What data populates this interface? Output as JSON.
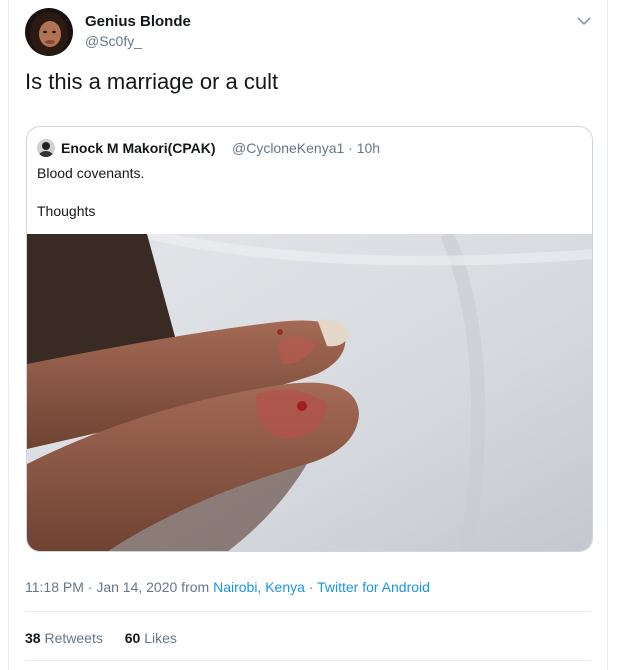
{
  "author": {
    "name": "Genius Blonde",
    "handle": "@Sc0fy_"
  },
  "tweet": {
    "text": "Is this a marriage or a cult"
  },
  "quoted": {
    "name": "Enock M Makori(CPAK)",
    "handle_time": "@CycloneKenya1 · 10h",
    "line1": "Blood covenants.",
    "line2": "Thoughts"
  },
  "meta": {
    "timestamp": "11:18 PM · Jan 14, 2020 from",
    "location": "Nairobi, Kenya",
    "separator": "·",
    "source": "Twitter for Android"
  },
  "stats": {
    "retweets_count": "38",
    "retweets_label": "Retweets",
    "likes_count": "60",
    "likes_label": "Likes"
  },
  "icons": {
    "caret": "chevron-down-icon"
  },
  "colors": {
    "link": "#1b95e0",
    "secondary_text": "#657786",
    "border": "#ccd6dd"
  }
}
